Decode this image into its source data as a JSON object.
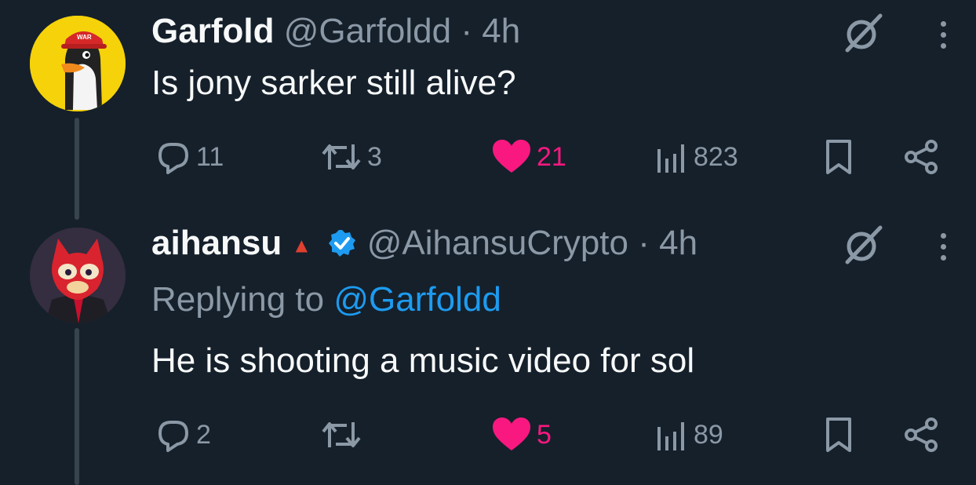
{
  "tweets": [
    {
      "name": "Garfold",
      "handle": "@Garfoldd",
      "separator": "·",
      "time": "4h",
      "text": "Is jony sarker still alive?",
      "avatar_cap_text": "WAR",
      "stats": {
        "replies": "11",
        "reposts": "3",
        "likes": "21",
        "views": "823"
      }
    },
    {
      "name": "aihansu",
      "badge": "▲",
      "handle": "@AihansuCrypto",
      "separator": "·",
      "time": "4h",
      "replying_label": "Replying to",
      "replying_to": "@Garfoldd",
      "text": "He is shooting a music video for sol",
      "stats": {
        "replies": "2",
        "reposts": "",
        "likes": "5",
        "views": "89"
      }
    }
  ],
  "colors": {
    "background": "#15202b",
    "muted": "#8b98a5",
    "accent": "#1d9bf0",
    "like": "#f91880",
    "thread_line": "#38444d"
  },
  "icons": [
    "grok-icon",
    "more-icon",
    "reply-icon",
    "repost-icon",
    "like-icon",
    "views-icon",
    "bookmark-icon",
    "share-icon",
    "verified-icon"
  ]
}
